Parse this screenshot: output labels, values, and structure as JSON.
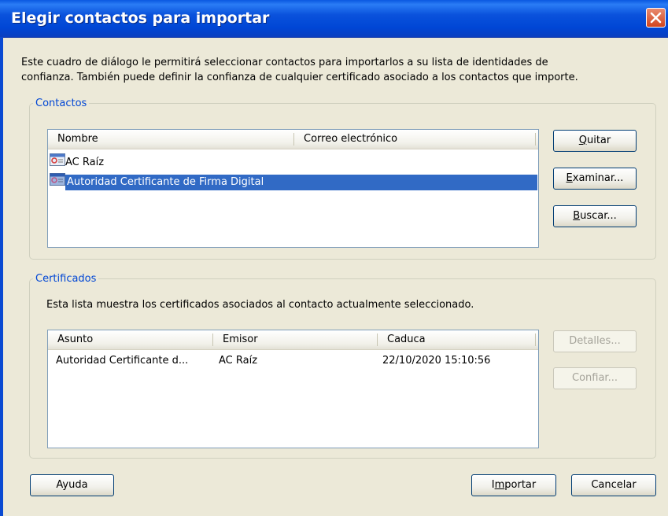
{
  "window": {
    "title": "Elegir contactos para importar",
    "description": "Este cuadro de diálogo le permitirá seleccionar contactos para importarlos a su lista de identidades de\nconfianza. También puede definir la confianza de cualquier certificado asociado a los contactos que importe."
  },
  "contacts": {
    "legend": "Contactos",
    "columns": [
      "Nombre",
      "Correo electrónico"
    ],
    "rows": [
      {
        "name": "AC Raíz",
        "email": "",
        "icon": "certificate-icon",
        "selected": false
      },
      {
        "name": "Autoridad Certificante de Firma Digital",
        "email": "",
        "icon": "certificate-icon",
        "selected": true
      }
    ],
    "buttons": {
      "remove": {
        "before": "",
        "key": "Q",
        "after": "uitar"
      },
      "browse": {
        "before": "",
        "key": "E",
        "after": "xaminar..."
      },
      "search": {
        "before": "",
        "key": "B",
        "after": "uscar..."
      }
    }
  },
  "certificates": {
    "legend": "Certificados",
    "description": "Esta lista muestra los certificados asociados al contacto actualmente seleccionado.",
    "columns": [
      "Asunto",
      "Emisor",
      "Caduca"
    ],
    "rows": [
      {
        "subject": "Autoridad Certificante d...",
        "issuer": "AC Raíz",
        "expires": "22/10/2020 15:10:56"
      }
    ],
    "buttons": {
      "details": "Detalles...",
      "trust": "Confiar..."
    }
  },
  "footer": {
    "help": "Ayuda",
    "import": {
      "before": "I",
      "key": "m",
      "after": "portar"
    },
    "cancel": "Cancelar"
  },
  "colors": {
    "titlebar": "#0046d5",
    "selection": "#316ac5",
    "legend": "#0046d5",
    "close": "#d2451f"
  }
}
